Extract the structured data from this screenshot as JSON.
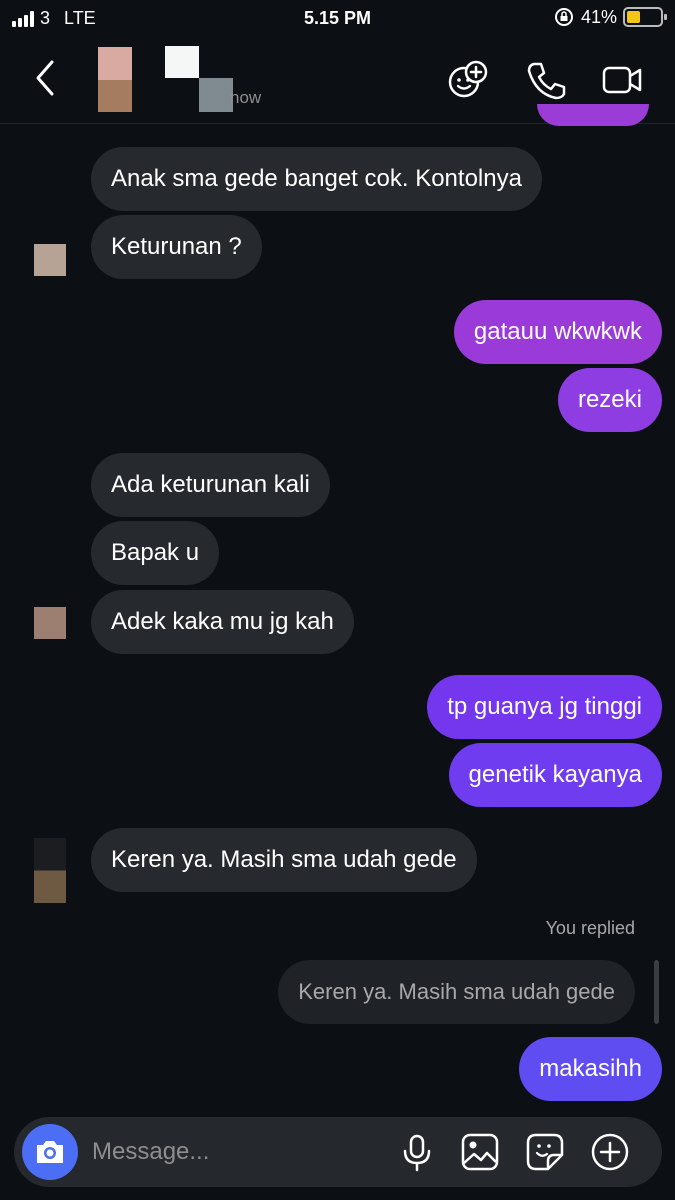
{
  "status": {
    "carrier": "3",
    "network": "LTE",
    "time": "5.15 PM",
    "battery": "41%",
    "battery_level": 0.41
  },
  "header": {
    "subtitle": "now"
  },
  "messages": [
    {
      "text": "Anak sma gede banget cok. Kontolnya",
      "dir": "in"
    },
    {
      "text": "Keturunan ?",
      "dir": "in"
    },
    {
      "text": "gatauu wkwkwk",
      "dir": "out"
    },
    {
      "text": "rezeki",
      "dir": "out"
    },
    {
      "text": "Ada keturunan kali",
      "dir": "in"
    },
    {
      "text": "Bapak u",
      "dir": "in"
    },
    {
      "text": "Adek kaka mu jg kah",
      "dir": "in"
    },
    {
      "text": "tp guanya jg tinggi",
      "dir": "out"
    },
    {
      "text": "genetik kayanya",
      "dir": "out"
    },
    {
      "text": "Keren ya. Masih sma udah gede",
      "dir": "in"
    },
    {
      "text": "makasihh",
      "dir": "out"
    }
  ],
  "reply": {
    "label": "You replied",
    "quote": "Keren ya. Masih sma udah gede"
  },
  "composer": {
    "placeholder": "Message..."
  },
  "colors": {
    "background": "#0c1014",
    "incoming": "#26292e",
    "outgoing_purple": "#9b3cd7",
    "outgoing_violet": "#7c3aed",
    "outgoing_blue": "#6a4cf0",
    "camera": "#4c6ef5"
  },
  "icons": [
    "back-icon",
    "add-people-icon",
    "phone-icon",
    "video-icon",
    "camera-icon",
    "microphone-icon",
    "gallery-icon",
    "sticker-icon",
    "plus-icon"
  ]
}
